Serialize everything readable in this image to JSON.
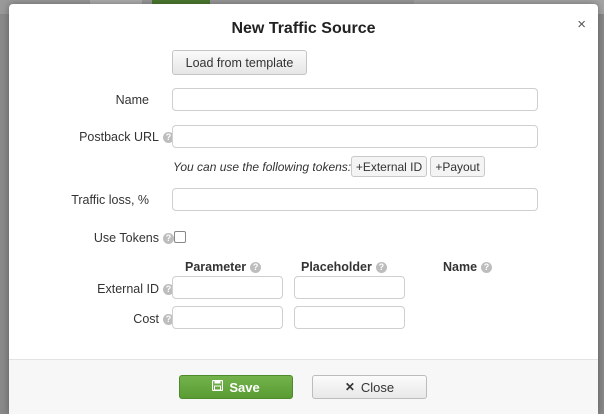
{
  "modal": {
    "title": "New Traffic Source",
    "close_icon": "×",
    "load_template_label": "Load from template"
  },
  "fields": {
    "name_label": "Name",
    "postback_label": "Postback URL",
    "tokens_hint": "You can use the following tokens:",
    "token_external_id": "+External ID",
    "token_payout": "+Payout",
    "traffic_loss_label": "Traffic loss, %",
    "use_tokens_label": "Use Tokens"
  },
  "params": {
    "col_parameter": "Parameter",
    "col_placeholder": "Placeholder",
    "col_name": "Name",
    "row_external_id": "External ID",
    "row_cost": "Cost"
  },
  "footer": {
    "save_label": "Save",
    "close_label": "Close"
  },
  "icons": {
    "help": "?",
    "save": "floppy-disk-icon",
    "close": "x-icon"
  },
  "colors": {
    "save_green": "#5fa33a",
    "overlay": "#8a8a8a"
  }
}
